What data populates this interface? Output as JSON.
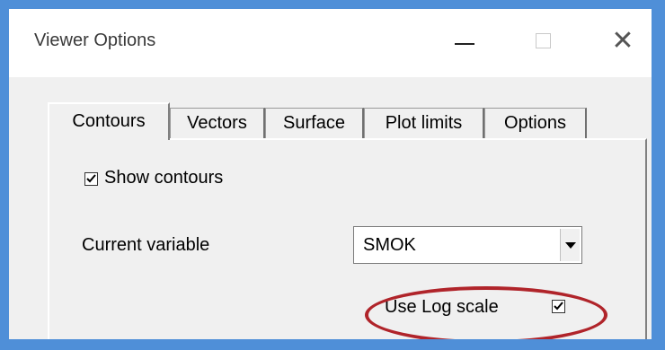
{
  "window": {
    "title": "Viewer Options",
    "controls": {
      "minimize_icon": "minimize-icon",
      "maximize_icon": "maximize-icon",
      "close_icon": "close-icon",
      "close_glyph": "✕"
    }
  },
  "tabs": [
    {
      "label": "Contours",
      "active": true
    },
    {
      "label": "Vectors",
      "active": false
    },
    {
      "label": "Surface",
      "active": false
    },
    {
      "label": "Plot limits",
      "active": false
    },
    {
      "label": "Options",
      "active": false
    }
  ],
  "contours": {
    "show_contours": {
      "label": "Show contours",
      "checked": true
    },
    "current_variable": {
      "label": "Current variable",
      "value": "SMOK"
    },
    "use_log_scale": {
      "label": "Use Log scale",
      "checked": true,
      "highlight_color": "#b0242a"
    }
  },
  "colors": {
    "frame": "#4f8fd8",
    "window_bg": "#f0f0f0",
    "titlebar_bg": "#ffffff"
  }
}
